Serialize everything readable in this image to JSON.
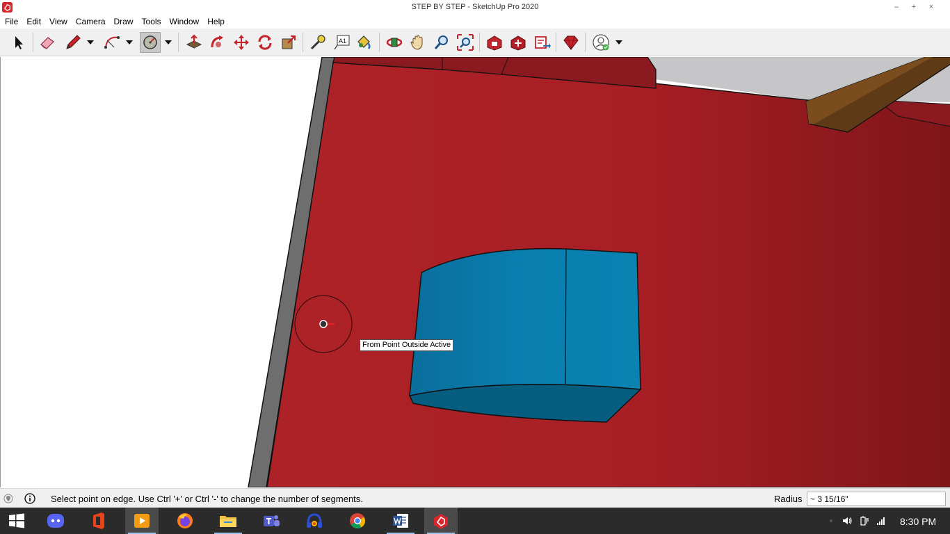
{
  "window": {
    "title": "STEP BY STEP - SketchUp Pro 2020",
    "minimize": "–",
    "maximize": "+",
    "close": "×"
  },
  "menu": [
    "File",
    "Edit",
    "View",
    "Camera",
    "Draw",
    "Tools",
    "Window",
    "Help"
  ],
  "toolbar": {
    "tools": [
      "select",
      "eraser",
      "pencil",
      "arc",
      "circle",
      "push-pull",
      "follow-me",
      "move",
      "rotate",
      "scale",
      "tape-measure",
      "text",
      "paint-bucket",
      "orbit",
      "pan",
      "zoom",
      "zoom-extents",
      "warehouse",
      "extension-warehouse",
      "send-to-layout",
      "ruby",
      "account"
    ],
    "active_tool": "circle",
    "text_tool_label": "A1"
  },
  "viewport": {
    "tooltip": "From Point Outside Active",
    "colors": {
      "wall": "#ad2227",
      "wall_shadow": "#7f1519",
      "box_front": "#0a7fb0",
      "box_bottom": "#065d80",
      "beam": "#5e3a16",
      "ceiling": "#c6c6c8"
    }
  },
  "status": {
    "message": "Select point on edge. Use Ctrl '+' or Ctrl '-' to change the number of segments.",
    "vcb_label": "Radius",
    "vcb_value": "~ 3 15/16\""
  },
  "taskbar": {
    "apps": [
      "discord",
      "office",
      "media-player",
      "firefox",
      "file-explorer",
      "teams",
      "app-music",
      "chrome",
      "word",
      "sketchup"
    ],
    "active_app": "sketchup",
    "clock": "8:30 PM"
  }
}
